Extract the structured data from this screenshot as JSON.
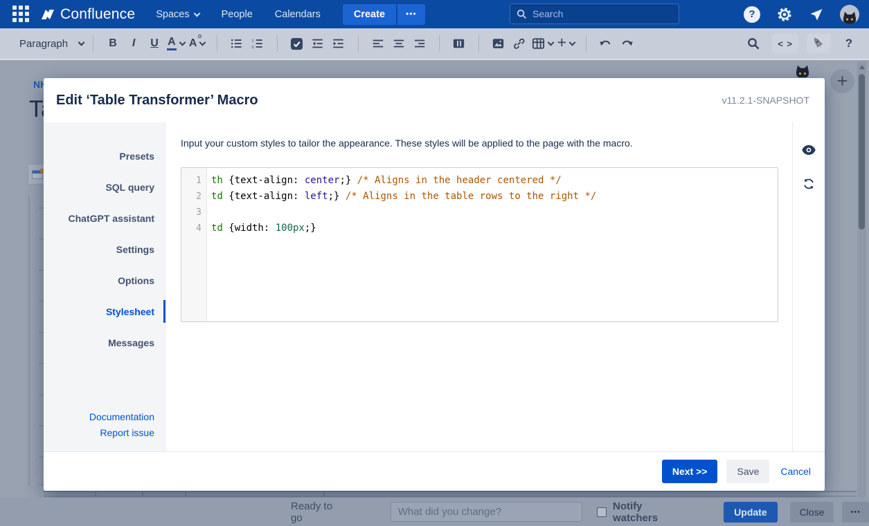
{
  "nav": {
    "brand": "Confluence",
    "menu": [
      {
        "label": "Spaces"
      },
      {
        "label": "People"
      },
      {
        "label": "Calendars"
      }
    ],
    "create_label": "Create",
    "more_label": "•••",
    "search_placeholder": "Search"
  },
  "toolbar": {
    "style_label": "Paragraph",
    "bold": "B",
    "italic": "I",
    "underline": "U",
    "color_letter": "A",
    "format_letter": "A",
    "plus_label": "+",
    "source_label": "< >",
    "help_label": "?"
  },
  "behind": {
    "breadcrumb": "NK",
    "title_fragment": "Ta"
  },
  "dialog": {
    "title": "Edit ‘Table Transformer’ Macro",
    "version": "v11.2.1-SNAPSHOT",
    "sidebar": {
      "items": [
        {
          "label": "Presets",
          "active": false
        },
        {
          "label": "SQL query",
          "active": false
        },
        {
          "label": "ChatGPT assistant",
          "active": false
        },
        {
          "label": "Settings",
          "active": false
        },
        {
          "label": "Options",
          "active": false
        },
        {
          "label": "Stylesheet",
          "active": true
        },
        {
          "label": "Messages",
          "active": false
        }
      ],
      "links": [
        {
          "label": "Documentation"
        },
        {
          "label": "Report issue"
        }
      ]
    },
    "description": "Input your custom styles to tailor the appearance. These styles will be applied to the page with the macro.",
    "editor": {
      "lines": [
        {
          "num": 1,
          "tokens": [
            {
              "t": "tag",
              "v": "th"
            },
            {
              "t": "plain",
              "v": " {text-align: "
            },
            {
              "t": "atom",
              "v": "center"
            },
            {
              "t": "plain",
              "v": ";} "
            },
            {
              "t": "comment",
              "v": "/* Aligns in the header centered */"
            }
          ]
        },
        {
          "num": 2,
          "tokens": [
            {
              "t": "tag",
              "v": "td"
            },
            {
              "t": "plain",
              "v": " {text-align: "
            },
            {
              "t": "atom",
              "v": "left"
            },
            {
              "t": "plain",
              "v": ";} "
            },
            {
              "t": "comment",
              "v": "/* Aligns in the table rows to the right */"
            }
          ]
        },
        {
          "num": 3,
          "tokens": []
        },
        {
          "num": 4,
          "tokens": [
            {
              "t": "tag",
              "v": "td"
            },
            {
              "t": "plain",
              "v": " {width: "
            },
            {
              "t": "number",
              "v": "100px"
            },
            {
              "t": "plain",
              "v": ";}"
            }
          ]
        }
      ]
    },
    "footer": {
      "next_label": "Next >>",
      "save_label": "Save",
      "cancel_label": "Cancel"
    }
  },
  "bottom_bar": {
    "status": "Ready to go",
    "change_placeholder": "What did you change?",
    "notify_label": "Notify watchers",
    "update_label": "Update",
    "close_label": "Close",
    "more_label": "•••"
  },
  "colors": {
    "accent_blue": "#0052cc",
    "nav_blue": "#0b4aa2",
    "code_tag": "#117700",
    "code_atom": "#221199",
    "code_number": "#116644",
    "code_comment": "#aa5500"
  }
}
